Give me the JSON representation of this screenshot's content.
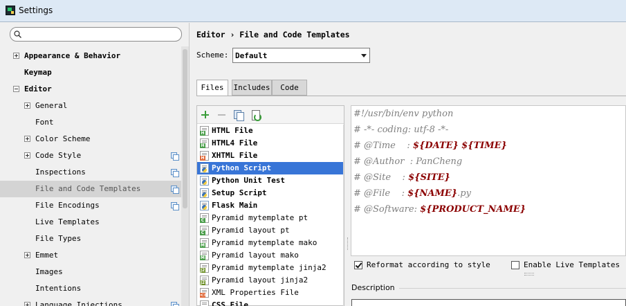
{
  "window": {
    "title": "Settings"
  },
  "search": {
    "placeholder": ""
  },
  "sidebar": {
    "items": [
      {
        "label": "Appearance & Behavior",
        "expander": "plus",
        "bold": true
      },
      {
        "label": "Keymap",
        "expander": "none",
        "bold": true
      },
      {
        "label": "Editor",
        "expander": "minus",
        "bold": true
      },
      {
        "label": "General",
        "expander": "plus",
        "bold": false
      },
      {
        "label": "Font",
        "expander": "none",
        "bold": false
      },
      {
        "label": "Color Scheme",
        "expander": "plus",
        "bold": false
      },
      {
        "label": "Code Style",
        "expander": "plus",
        "bold": false,
        "copy_icon": true
      },
      {
        "label": "Inspections",
        "expander": "none",
        "bold": false,
        "copy_icon": true
      },
      {
        "label": "File and Code Templates",
        "expander": "none",
        "bold": false,
        "copy_icon": true,
        "selected": true
      },
      {
        "label": "File Encodings",
        "expander": "none",
        "bold": false,
        "copy_icon": true
      },
      {
        "label": "Live Templates",
        "expander": "none",
        "bold": false
      },
      {
        "label": "File Types",
        "expander": "none",
        "bold": false
      },
      {
        "label": "Emmet",
        "expander": "plus",
        "bold": false
      },
      {
        "label": "Images",
        "expander": "none",
        "bold": false
      },
      {
        "label": "Intentions",
        "expander": "none",
        "bold": false
      },
      {
        "label": "Language Injections",
        "expander": "plus",
        "bold": false,
        "copy_icon": true
      }
    ]
  },
  "main": {
    "breadcrumb": "Editor › File and Code Templates",
    "scheme_label": "Scheme:",
    "scheme_value": "Default",
    "tabs": [
      {
        "label": "Files",
        "active": true
      },
      {
        "label": "Includes",
        "active": false
      },
      {
        "label": "Code",
        "active": false
      }
    ]
  },
  "files": [
    {
      "name": "HTML File",
      "icon": "H",
      "badge_color": "#4a9d4a",
      "bold": true
    },
    {
      "name": "HTML4 File",
      "icon": "H",
      "badge_color": "#4a9d4a",
      "bold": true
    },
    {
      "name": "XHTML File",
      "icon": "H",
      "badge_color": "#e06a3a",
      "bold": true
    },
    {
      "name": "Python Script",
      "icon": "py",
      "bold": true,
      "selected": true
    },
    {
      "name": "Python Unit Test",
      "icon": "py",
      "bold": true
    },
    {
      "name": "Setup Script",
      "icon": "py",
      "bold": true
    },
    {
      "name": "Flask Main",
      "icon": "py",
      "bold": true
    },
    {
      "name": "Pyramid mytemplate pt",
      "icon": "C",
      "badge_color": "#4a9d4a",
      "bold": false
    },
    {
      "name": "Pyramid layout pt",
      "icon": "C",
      "badge_color": "#4a9d4a",
      "bold": false
    },
    {
      "name": "Pyramid mytemplate mako",
      "icon": "M",
      "badge_color": "#4a9d4a",
      "bold": false
    },
    {
      "name": "Pyramid layout mako",
      "icon": "M",
      "badge_color": "#4a9d4a",
      "bold": false
    },
    {
      "name": "Pyramid mytemplate jinja2",
      "icon": "J2",
      "badge_color": "#6b8e23",
      "bold": false
    },
    {
      "name": "Pyramid layout jinja2",
      "icon": "J2",
      "badge_color": "#6b8e23",
      "bold": false
    },
    {
      "name": "XML Properties File",
      "icon": "<>",
      "badge_color": "#e06a3a",
      "bold": false
    },
    {
      "name": "CSS File",
      "icon": "",
      "badge_color": "#5a7fa8",
      "bold": true
    }
  ],
  "editor": {
    "lines": [
      [
        {
          "t": "#!/usr/bin/env python",
          "k": "txt"
        }
      ],
      [
        {
          "t": "# -*- coding: utf-8 -*-",
          "k": "txt"
        }
      ],
      [
        {
          "t": "# @Time    : ",
          "k": "txt"
        },
        {
          "t": "${DATE}",
          "k": "var"
        },
        {
          "t": " ",
          "k": "txt"
        },
        {
          "t": "${TIME}",
          "k": "var"
        }
      ],
      [
        {
          "t": "# @Author  : PanCheng",
          "k": "txt"
        }
      ],
      [
        {
          "t": "# @Site    : ",
          "k": "txt"
        },
        {
          "t": "${SITE}",
          "k": "var"
        }
      ],
      [
        {
          "t": "# @File    : ",
          "k": "txt"
        },
        {
          "t": "${NAME}",
          "k": "var"
        },
        {
          "t": ".py",
          "k": "txt"
        }
      ],
      [
        {
          "t": "# @Software: ",
          "k": "txt"
        },
        {
          "t": "${PRODUCT_NAME}",
          "k": "var"
        }
      ]
    ]
  },
  "options": {
    "reformat_label": "Reformat according to style",
    "reformat_checked": true,
    "live_templates_label": "Enable Live Templates",
    "live_templates_checked": false
  },
  "description": {
    "label": "Description"
  }
}
